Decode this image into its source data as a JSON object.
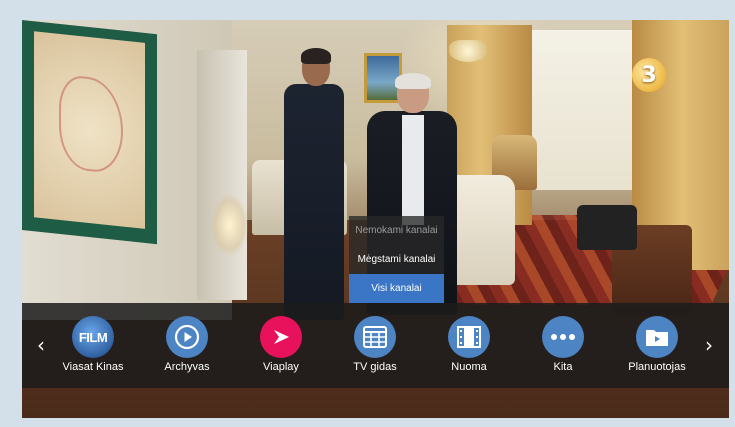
{
  "channel_logo": "3",
  "submenu": {
    "items": [
      {
        "label": "Nemokami kanalai",
        "state": "disabled"
      },
      {
        "label": "Mėgstami kanalai",
        "state": "normal"
      },
      {
        "label": "Visi kanalai",
        "state": "selected"
      }
    ]
  },
  "menu_bar": {
    "prev_arrow": "‹",
    "next_arrow": "›",
    "items": [
      {
        "label": "Viasat Kinas",
        "icon": "film-logo-icon",
        "icon_text": "FILM"
      },
      {
        "label": "Archyvas",
        "icon": "play-circle-icon"
      },
      {
        "label": "Viaplay",
        "icon": "viaplay-logo-icon"
      },
      {
        "label": "TV gidas",
        "icon": "calendar-grid-icon"
      },
      {
        "label": "Nuoma",
        "icon": "film-strip-icon"
      },
      {
        "label": "Kita",
        "icon": "more-dots-icon"
      },
      {
        "label": "Planuotojas",
        "icon": "folder-icon"
      }
    ]
  },
  "colors": {
    "accent": "#3a76c5",
    "icon_bg": "#4d84c3",
    "viaplay": "#e8125c",
    "background": "#d3dfe9"
  }
}
